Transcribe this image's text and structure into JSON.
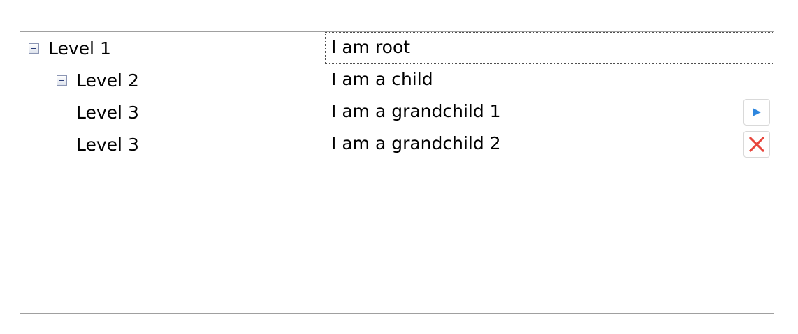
{
  "tree": {
    "rows": [
      {
        "label": "Level 1",
        "value": "I am root",
        "expanded": true
      },
      {
        "label": "Level 2",
        "value": "I am a child",
        "expanded": true
      },
      {
        "label": "Level 3",
        "value": "I am a grandchild 1",
        "action_icon": "play-icon"
      },
      {
        "label": "Level 3",
        "value": "I am a grandchild 2",
        "action_icon": "close-icon"
      }
    ]
  },
  "colors": {
    "play": "#2e86de",
    "close": "#e8453c",
    "border": "#a0a0a0"
  }
}
